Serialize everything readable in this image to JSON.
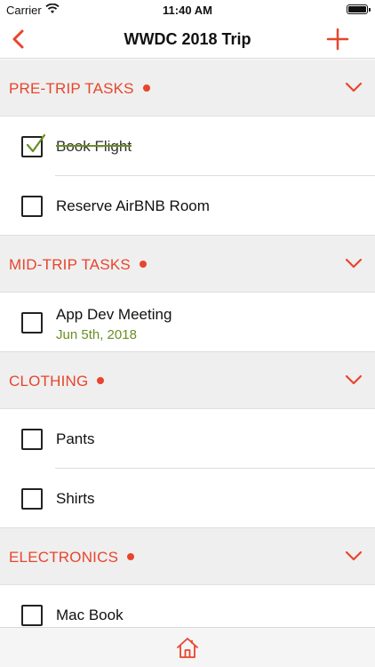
{
  "status_bar": {
    "carrier": "Carrier",
    "time": "11:40 AM"
  },
  "nav": {
    "title": "WWDC 2018 Trip"
  },
  "sections": [
    {
      "title": "PRE-TRIP TASKS",
      "items": [
        {
          "label": "Book Flight",
          "checked": true
        },
        {
          "label": "Reserve AirBNB Room",
          "checked": false
        }
      ]
    },
    {
      "title": "MID-TRIP TASKS",
      "items": [
        {
          "label": "App Dev Meeting",
          "date": "Jun 5th, 2018",
          "checked": false
        }
      ]
    },
    {
      "title": "CLOTHING",
      "items": [
        {
          "label": "Pants",
          "checked": false
        },
        {
          "label": "Shirts",
          "checked": false
        }
      ]
    },
    {
      "title": "ELECTRONICS",
      "items": [
        {
          "label": "Mac Book",
          "checked": false
        }
      ]
    }
  ],
  "colors": {
    "accent": "#e8452c",
    "done": "#6b8e23",
    "header_bg": "#efefef"
  },
  "icons": [
    "back-chevron-icon",
    "plus-icon",
    "chevron-down-icon",
    "checkmark-icon",
    "home-icon",
    "wifi-icon",
    "battery-icon"
  ]
}
